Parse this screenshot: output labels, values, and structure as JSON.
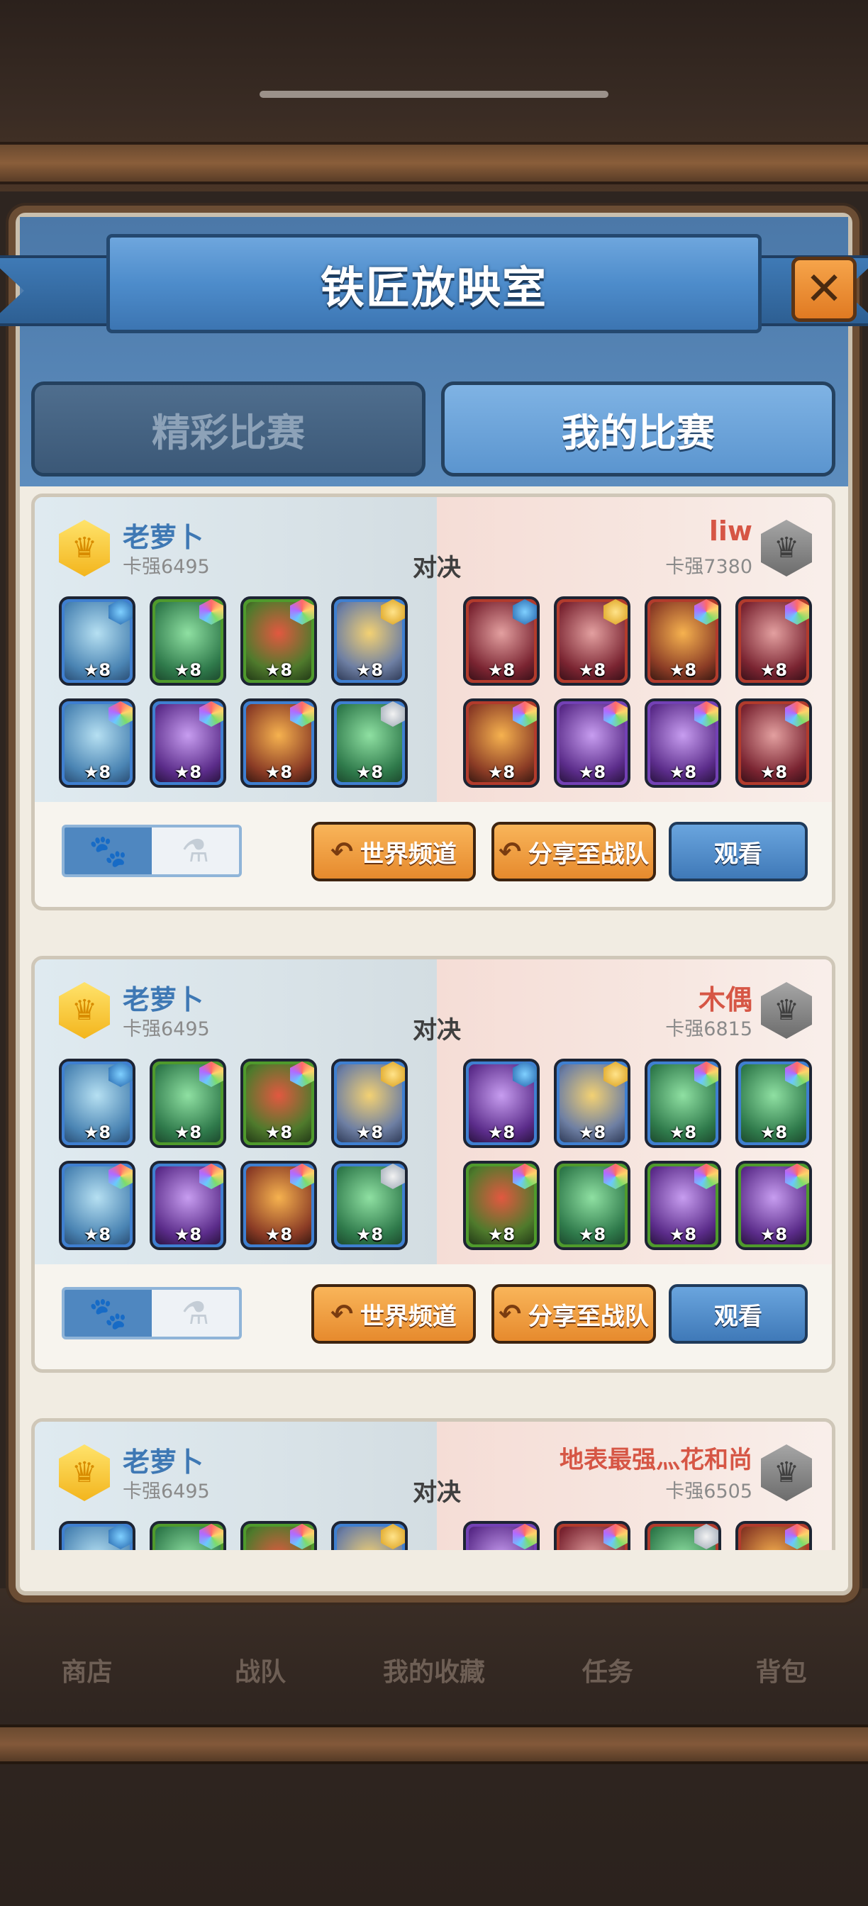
{
  "dialog": {
    "title": "铁匠放映室",
    "close_icon": "✕"
  },
  "tabs": [
    {
      "label": "精彩比赛",
      "active": false
    },
    {
      "label": "我的比赛",
      "active": true
    }
  ],
  "vs_label": "对决",
  "matches": [
    {
      "left": {
        "name": "老萝卜",
        "power": "卡强6495"
      },
      "right": {
        "name": "liw",
        "power": "卡强7380"
      },
      "buttons": {
        "world": "世界频道",
        "share": "分享至战队",
        "watch": "观看"
      },
      "left_units": [
        "★8",
        "★8",
        "★8",
        "★8",
        "★8",
        "★8",
        "★8",
        "★8"
      ],
      "right_units": [
        "★8",
        "★8",
        "★8",
        "★8",
        "★8",
        "★8",
        "★8",
        "★8"
      ]
    },
    {
      "left": {
        "name": "老萝卜",
        "power": "卡强6495"
      },
      "right": {
        "name": "木偶",
        "power": "卡强6815"
      },
      "buttons": {
        "world": "世界频道",
        "share": "分享至战队",
        "watch": "观看"
      },
      "left_units": [
        "★8",
        "★8",
        "★8",
        "★8",
        "★8",
        "★8",
        "★8",
        "★8"
      ],
      "right_units": [
        "★8",
        "★8",
        "★8",
        "★8",
        "★8",
        "★8",
        "★8",
        "★8"
      ]
    },
    {
      "left": {
        "name": "老萝卜",
        "power": "卡强6495"
      },
      "right": {
        "name": "地表最强灬花和尚",
        "power": "卡强6505"
      }
    }
  ],
  "bottom_nav": [
    "商店",
    "战队",
    "我的收藏",
    "任务",
    "背包"
  ],
  "colors": {
    "left_player": "#3e78b4",
    "right_player": "#d65645",
    "accent_orange": "#e68a2d",
    "accent_blue": "#3f79b8"
  }
}
